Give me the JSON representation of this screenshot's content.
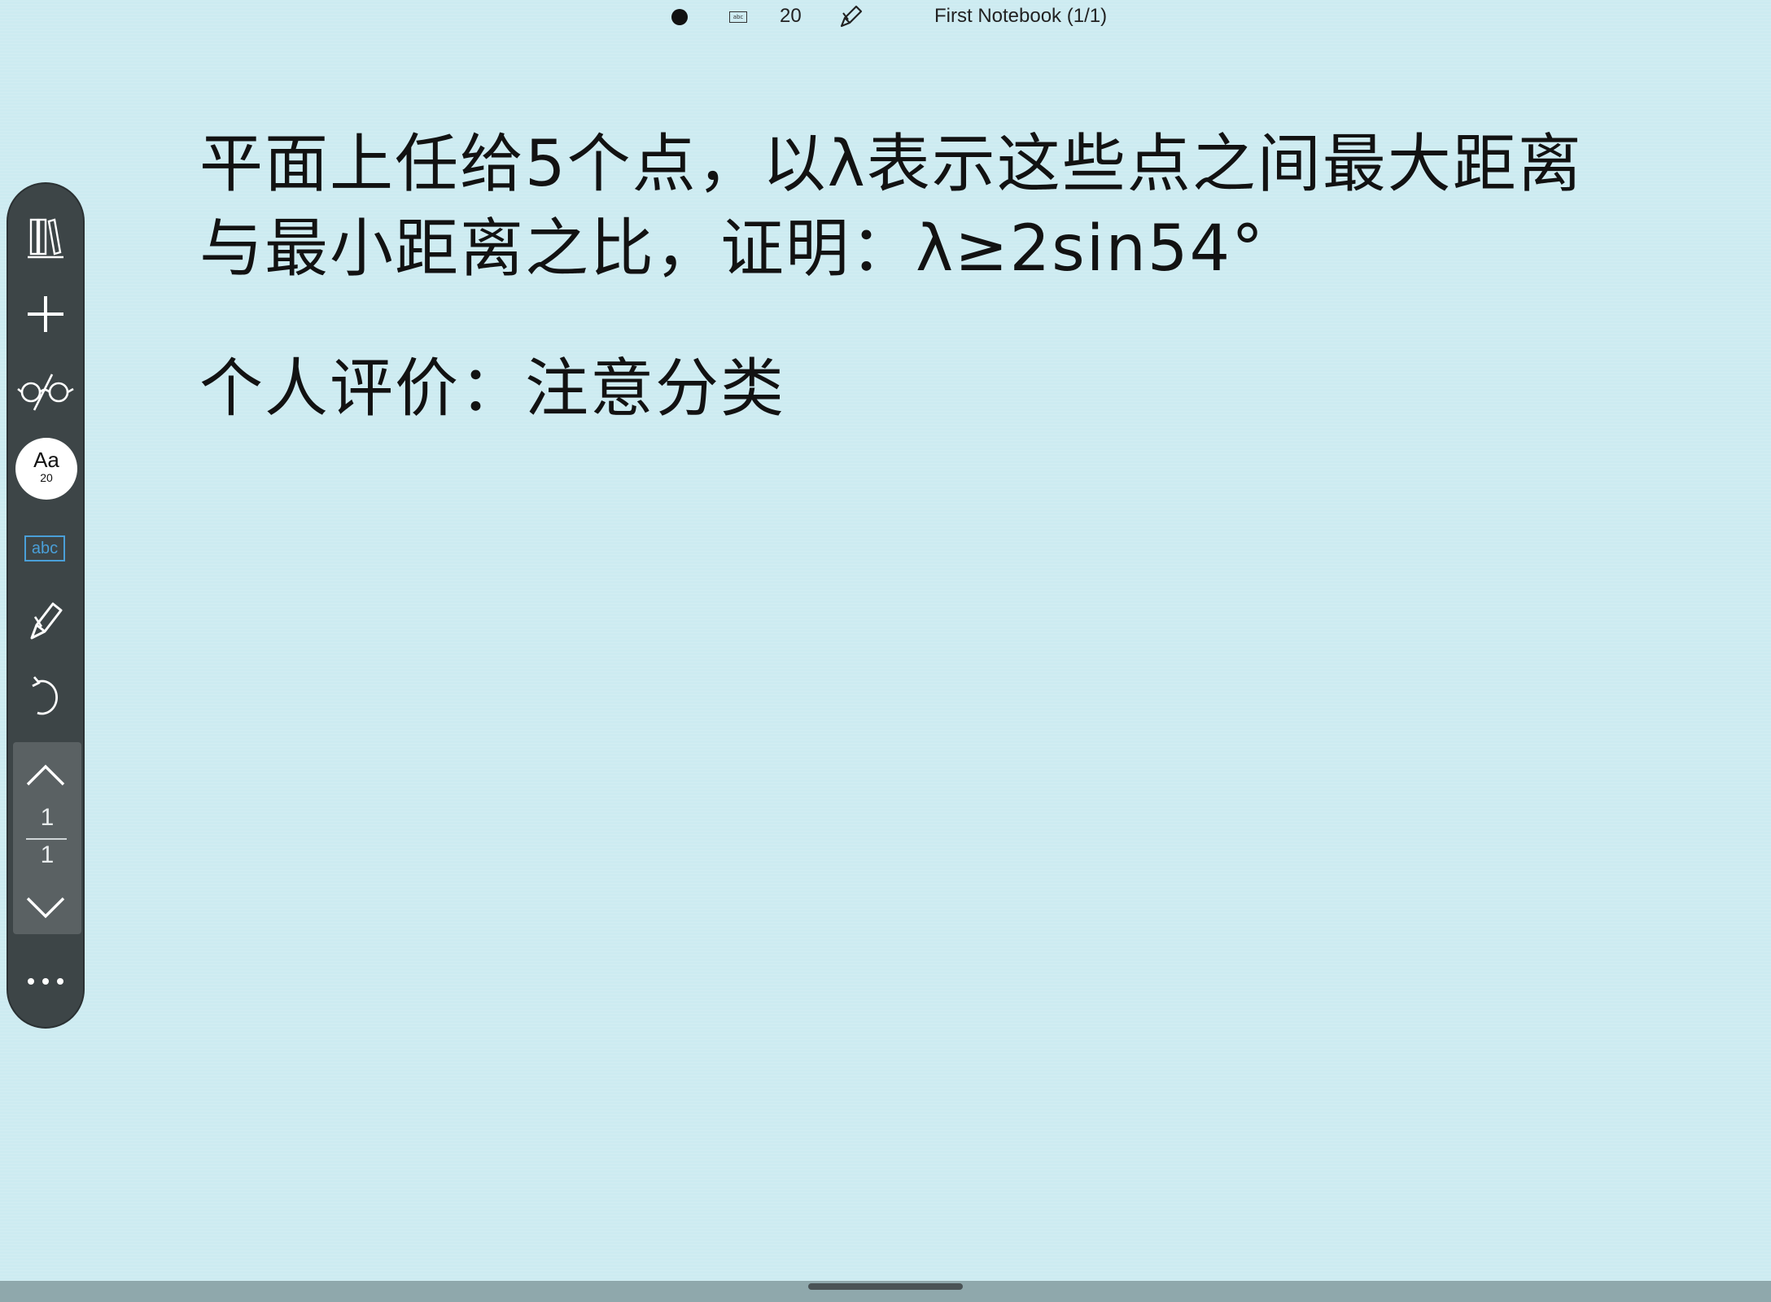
{
  "status_bar": {
    "abc_label": "abc",
    "font_size": "20",
    "notebook_title": "First Notebook (1/1)"
  },
  "toolbar": {
    "font_button": {
      "label": "Aa",
      "size": "20"
    },
    "abc_label": "abc",
    "pager": {
      "current": "1",
      "total": "1"
    },
    "icons": [
      "library-icon",
      "plus-icon",
      "glasses-icon",
      "font-icon",
      "abc-text-icon",
      "pen-icon",
      "undo-icon",
      "chevron-up-icon",
      "chevron-down-icon",
      "more-icon"
    ],
    "colors": {
      "background": "#3d4547",
      "pager_bg": "#5a6163",
      "abc_accent": "#4a9fd8"
    }
  },
  "note": {
    "lines": [
      "平面上任给5个点，以λ表示这些点之间最大距离",
      "与最小距离之比，证明：λ≥2sin54°",
      "个人评价：注意分类"
    ]
  },
  "colors": {
    "paper": "#cdebf1",
    "text": "#121212"
  }
}
